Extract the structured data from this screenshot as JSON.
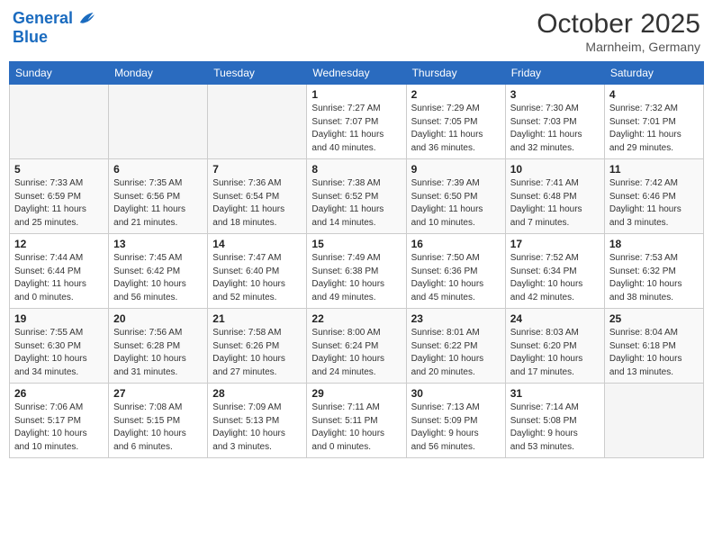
{
  "header": {
    "logo_line1": "General",
    "logo_line2": "Blue",
    "month": "October 2025",
    "location": "Marnheim, Germany"
  },
  "weekdays": [
    "Sunday",
    "Monday",
    "Tuesday",
    "Wednesday",
    "Thursday",
    "Friday",
    "Saturday"
  ],
  "weeks": [
    [
      {
        "day": "",
        "info": ""
      },
      {
        "day": "",
        "info": ""
      },
      {
        "day": "",
        "info": ""
      },
      {
        "day": "1",
        "info": "Sunrise: 7:27 AM\nSunset: 7:07 PM\nDaylight: 11 hours\nand 40 minutes."
      },
      {
        "day": "2",
        "info": "Sunrise: 7:29 AM\nSunset: 7:05 PM\nDaylight: 11 hours\nand 36 minutes."
      },
      {
        "day": "3",
        "info": "Sunrise: 7:30 AM\nSunset: 7:03 PM\nDaylight: 11 hours\nand 32 minutes."
      },
      {
        "day": "4",
        "info": "Sunrise: 7:32 AM\nSunset: 7:01 PM\nDaylight: 11 hours\nand 29 minutes."
      }
    ],
    [
      {
        "day": "5",
        "info": "Sunrise: 7:33 AM\nSunset: 6:59 PM\nDaylight: 11 hours\nand 25 minutes."
      },
      {
        "day": "6",
        "info": "Sunrise: 7:35 AM\nSunset: 6:56 PM\nDaylight: 11 hours\nand 21 minutes."
      },
      {
        "day": "7",
        "info": "Sunrise: 7:36 AM\nSunset: 6:54 PM\nDaylight: 11 hours\nand 18 minutes."
      },
      {
        "day": "8",
        "info": "Sunrise: 7:38 AM\nSunset: 6:52 PM\nDaylight: 11 hours\nand 14 minutes."
      },
      {
        "day": "9",
        "info": "Sunrise: 7:39 AM\nSunset: 6:50 PM\nDaylight: 11 hours\nand 10 minutes."
      },
      {
        "day": "10",
        "info": "Sunrise: 7:41 AM\nSunset: 6:48 PM\nDaylight: 11 hours\nand 7 minutes."
      },
      {
        "day": "11",
        "info": "Sunrise: 7:42 AM\nSunset: 6:46 PM\nDaylight: 11 hours\nand 3 minutes."
      }
    ],
    [
      {
        "day": "12",
        "info": "Sunrise: 7:44 AM\nSunset: 6:44 PM\nDaylight: 11 hours\nand 0 minutes."
      },
      {
        "day": "13",
        "info": "Sunrise: 7:45 AM\nSunset: 6:42 PM\nDaylight: 10 hours\nand 56 minutes."
      },
      {
        "day": "14",
        "info": "Sunrise: 7:47 AM\nSunset: 6:40 PM\nDaylight: 10 hours\nand 52 minutes."
      },
      {
        "day": "15",
        "info": "Sunrise: 7:49 AM\nSunset: 6:38 PM\nDaylight: 10 hours\nand 49 minutes."
      },
      {
        "day": "16",
        "info": "Sunrise: 7:50 AM\nSunset: 6:36 PM\nDaylight: 10 hours\nand 45 minutes."
      },
      {
        "day": "17",
        "info": "Sunrise: 7:52 AM\nSunset: 6:34 PM\nDaylight: 10 hours\nand 42 minutes."
      },
      {
        "day": "18",
        "info": "Sunrise: 7:53 AM\nSunset: 6:32 PM\nDaylight: 10 hours\nand 38 minutes."
      }
    ],
    [
      {
        "day": "19",
        "info": "Sunrise: 7:55 AM\nSunset: 6:30 PM\nDaylight: 10 hours\nand 34 minutes."
      },
      {
        "day": "20",
        "info": "Sunrise: 7:56 AM\nSunset: 6:28 PM\nDaylight: 10 hours\nand 31 minutes."
      },
      {
        "day": "21",
        "info": "Sunrise: 7:58 AM\nSunset: 6:26 PM\nDaylight: 10 hours\nand 27 minutes."
      },
      {
        "day": "22",
        "info": "Sunrise: 8:00 AM\nSunset: 6:24 PM\nDaylight: 10 hours\nand 24 minutes."
      },
      {
        "day": "23",
        "info": "Sunrise: 8:01 AM\nSunset: 6:22 PM\nDaylight: 10 hours\nand 20 minutes."
      },
      {
        "day": "24",
        "info": "Sunrise: 8:03 AM\nSunset: 6:20 PM\nDaylight: 10 hours\nand 17 minutes."
      },
      {
        "day": "25",
        "info": "Sunrise: 8:04 AM\nSunset: 6:18 PM\nDaylight: 10 hours\nand 13 minutes."
      }
    ],
    [
      {
        "day": "26",
        "info": "Sunrise: 7:06 AM\nSunset: 5:17 PM\nDaylight: 10 hours\nand 10 minutes."
      },
      {
        "day": "27",
        "info": "Sunrise: 7:08 AM\nSunset: 5:15 PM\nDaylight: 10 hours\nand 6 minutes."
      },
      {
        "day": "28",
        "info": "Sunrise: 7:09 AM\nSunset: 5:13 PM\nDaylight: 10 hours\nand 3 minutes."
      },
      {
        "day": "29",
        "info": "Sunrise: 7:11 AM\nSunset: 5:11 PM\nDaylight: 10 hours\nand 0 minutes."
      },
      {
        "day": "30",
        "info": "Sunrise: 7:13 AM\nSunset: 5:09 PM\nDaylight: 9 hours\nand 56 minutes."
      },
      {
        "day": "31",
        "info": "Sunrise: 7:14 AM\nSunset: 5:08 PM\nDaylight: 9 hours\nand 53 minutes."
      },
      {
        "day": "",
        "info": ""
      }
    ]
  ]
}
